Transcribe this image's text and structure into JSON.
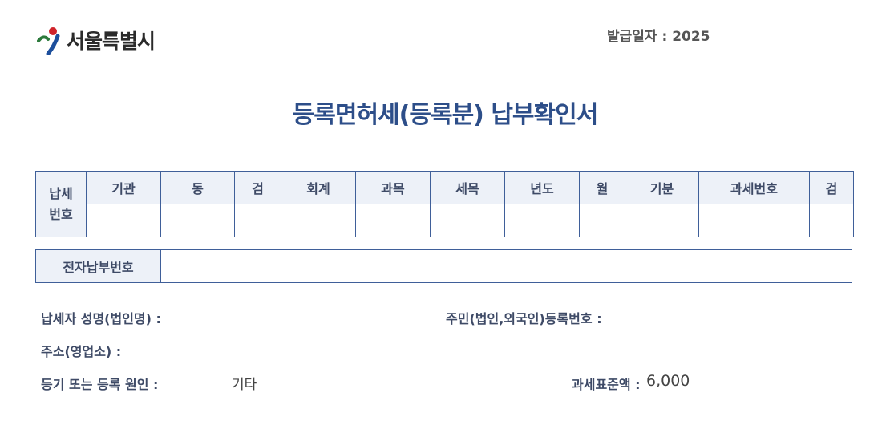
{
  "header": {
    "org_name": "서울특별시",
    "issue_date": "발급일자 : 2025"
  },
  "document": {
    "title": "등록면허세(등록분) 납부확인서"
  },
  "tax_number_table": {
    "row_label": "납세 번호",
    "columns": [
      "기관",
      "동",
      "검",
      "회계",
      "과목",
      "세목",
      "년도",
      "월",
      "기분",
      "과세번호",
      "검"
    ],
    "values": [
      "",
      "",
      "",
      "",
      "",
      "",
      "",
      "",
      "",
      "",
      ""
    ]
  },
  "electronic_payment": {
    "label": "전자납부번호",
    "value": ""
  },
  "fields": {
    "taxpayer_name_label": "납세자 성명(법인명) :",
    "resident_number_label": "주민(법인,외국인)등록번호 :",
    "address_label": "주소(영업소) :",
    "registration_cause_label": "등기 또는 등록 원인 :",
    "registration_cause_value": "기타",
    "tax_base_label": "과세표준액 :",
    "tax_base_value": "6,000"
  },
  "colors": {
    "title": "#2d4e89",
    "table_border": "#3f5f99",
    "header_fill": "#edf1f8",
    "label_text": "#3e4a66"
  }
}
